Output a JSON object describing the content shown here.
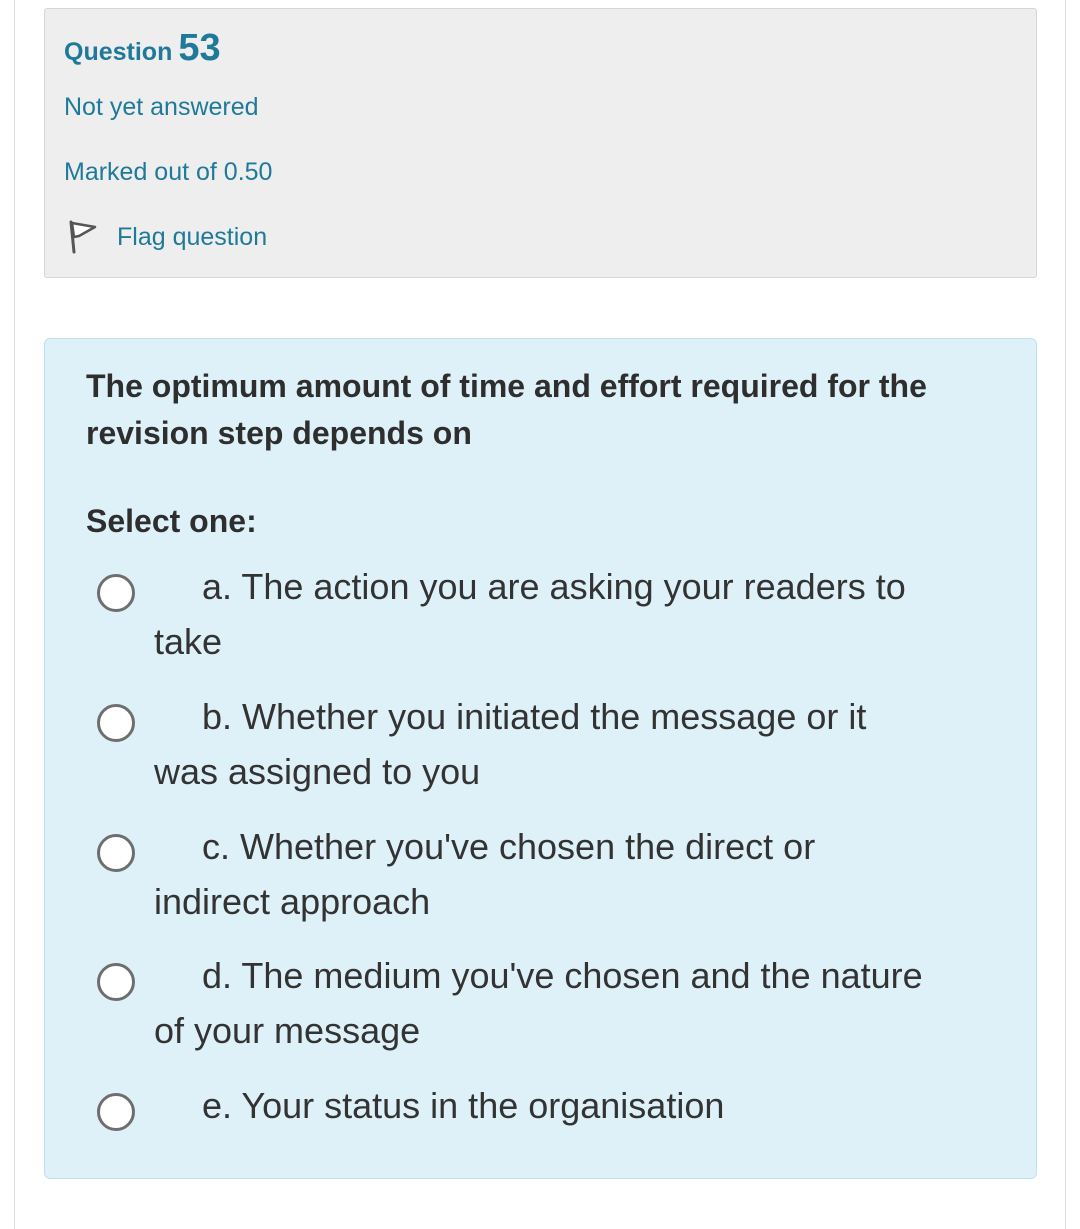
{
  "info": {
    "question_label": "Question",
    "question_number": "53",
    "state": "Not yet answered",
    "grade": "Marked out of 0.50",
    "flag_label": "Flag question",
    "flag_icon": "flag-icon"
  },
  "question": {
    "text": "The optimum amount of time and effort required for the revision step depends on",
    "prompt": "Select one:",
    "options": [
      {
        "label": "a. The action you are asking your readers to take"
      },
      {
        "label": "b. Whether you initiated the message or it was assigned to you"
      },
      {
        "label": "c. Whether you've chosen the direct or indirect approach"
      },
      {
        "label": "d. The medium you've chosen and the nature of your message"
      },
      {
        "label": "e. Your status in the organisation"
      }
    ]
  },
  "colors": {
    "accent": "#1f7a99",
    "info_bg": "#eeeeee",
    "content_bg": "#def1f9"
  }
}
